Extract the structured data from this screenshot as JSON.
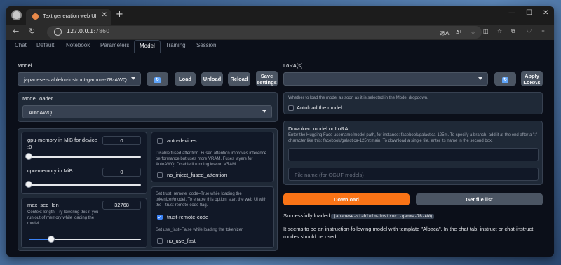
{
  "browser": {
    "tab_title": "Text generation web UI",
    "url_host": "127.0.0.1",
    "url_port": ":7860"
  },
  "tabs": [
    "Chat",
    "Default",
    "Notebook",
    "Parameters",
    "Model",
    "Training",
    "Session"
  ],
  "active_tab": "Model",
  "model": {
    "label": "Model",
    "selected": "japanese-stablelm-instruct-gamma-7B-AWQ",
    "buttons": {
      "load": "Load",
      "unload": "Unload",
      "reload": "Reload",
      "save_line1": "Save",
      "save_line2": "settings"
    }
  },
  "lora": {
    "label": "LoRA(s)",
    "apply_line1": "Apply",
    "apply_line2": "LoRAs"
  },
  "loader": {
    "label": "Model loader",
    "selected": "AutoAWQ"
  },
  "params": {
    "gpu_label_1": "gpu-memory in MiB for device",
    "gpu_label_2": ":0",
    "gpu_value": "0",
    "gpu_fraction": 0.0,
    "cpu_label": "cpu-memory in MiB",
    "cpu_value": "0",
    "cpu_fraction": 0.0,
    "seq_label": "max_seq_len",
    "seq_value": "32768",
    "seq_fraction": 0.2,
    "seq_desc": "Context length. Try lowering this if you run out of memory while loading the model."
  },
  "options": {
    "auto_devices": "auto-devices",
    "fused_desc": "Disable fused attention. Fused attention improves inference performance but uses more VRAM. Fuses layers for AutoAWQ. Disable if running low on VRAM.",
    "no_inject": "no_inject_fused_attention",
    "trust_desc": "Set trust_remote_code=True while loading the tokenizer/model. To enable this option, start the web UI with the --trust-remote-code flag.",
    "trust_label": "trust-remote-code",
    "trust_checked": true,
    "fast_desc": "Set use_fast=False while loading the tokenizer.",
    "no_fast": "no_use_fast"
  },
  "autoload": {
    "desc": "Whether to load the model as soon as it is selected in the Model dropdown.",
    "label": "Autoload the model"
  },
  "download": {
    "title": "Download model or LoRA",
    "desc": "Enter the Hugging Face username/model path, for instance: facebook/galactica-125m. To specify a branch, add it at the end after a \":\" character like this: facebook/galactica-125m:main. To download a single file, enter its name in the second box.",
    "file_placeholder": "File name (for GGUF models)",
    "download_btn": "Download",
    "file_list_btn": "Get file list"
  },
  "status": {
    "loaded_prefix": "Successfully loaded",
    "loaded_model": "japanese-stablelm-instruct-gamma-7B-AWQ",
    "loaded_suffix": ".",
    "template_msg": "It seems to be an instruction-following model with template \"Alpaca\". In the chat tab, instruct or chat-instruct modes should be used."
  },
  "colors": {
    "download": "#f97316",
    "accent": "#3b82f6",
    "background": "#0b0f19"
  },
  "icons": [
    "refresh-icon",
    "dropdown-caret-icon",
    "checkbox-icon"
  ]
}
